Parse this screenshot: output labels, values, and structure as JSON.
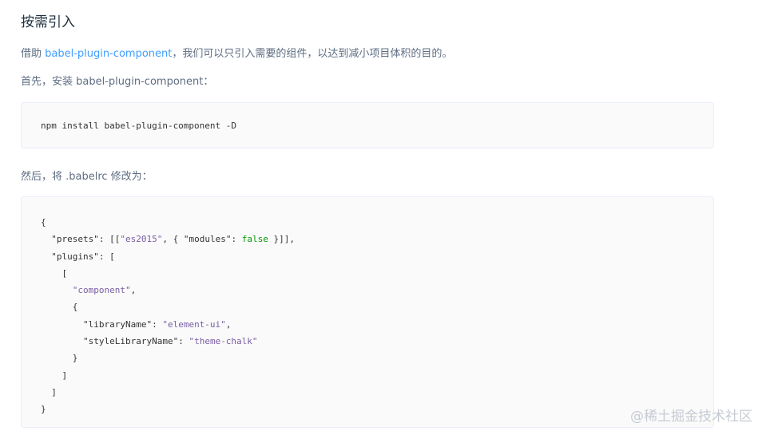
{
  "heading": "按需引入",
  "intro": {
    "prefix": "借助 ",
    "link": "babel-plugin-component",
    "suffix": "，我们可以只引入需要的组件，以达到减小项目体积的目的。"
  },
  "step1": "首先，安装 babel-plugin-component：",
  "install_command": "npm install babel-plugin-component -D",
  "step2": "然后，将 .babelrc 修改为：",
  "babelrc": {
    "open_brace": "{",
    "presets_key": "\"presets\"",
    "presets_open": ": [[",
    "es2015": "\"es2015\"",
    "comma_open": ", { ",
    "modules_key": "\"modules\"",
    "colon": ": ",
    "false_value": "false",
    "presets_close": " }]],",
    "plugins_key": "\"plugins\"",
    "plugins_open": ": [",
    "inner_open": "[",
    "component": "\"component\"",
    "comma": ",",
    "obj_open": "{",
    "libraryName_key": "\"libraryName\"",
    "libraryName_value": "\"element-ui\"",
    "styleLibraryName_key": "\"styleLibraryName\"",
    "styleLibraryName_value": "\"theme-chalk\"",
    "obj_close": "}",
    "inner_close": "]",
    "plugins_close": "]",
    "close_brace": "}"
  },
  "watermark": "@稀土掘金技术社区"
}
